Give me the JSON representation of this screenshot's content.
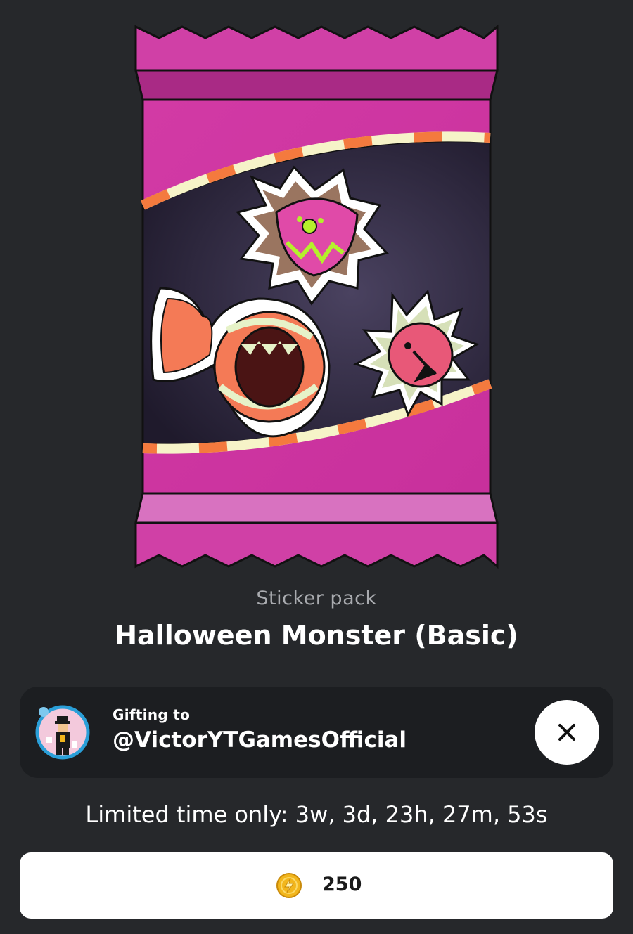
{
  "pack": {
    "type_label": "Sticker pack",
    "name": "Halloween Monster (Basic)"
  },
  "gift": {
    "label": "Gifting to",
    "username": "@VictorYTGamesOfficial"
  },
  "timer": {
    "text": "Limited time only: 3w, 3d, 23h, 27m, 53s"
  },
  "purchase": {
    "price": "250",
    "currency_icon": "coin-icon"
  },
  "colors": {
    "background": "#26282b",
    "card": "#1c1e21",
    "pack_pink": "#d63ba8",
    "pack_dark": "#2a2438",
    "button": "#ffffff",
    "coin": "#f2b61c"
  }
}
